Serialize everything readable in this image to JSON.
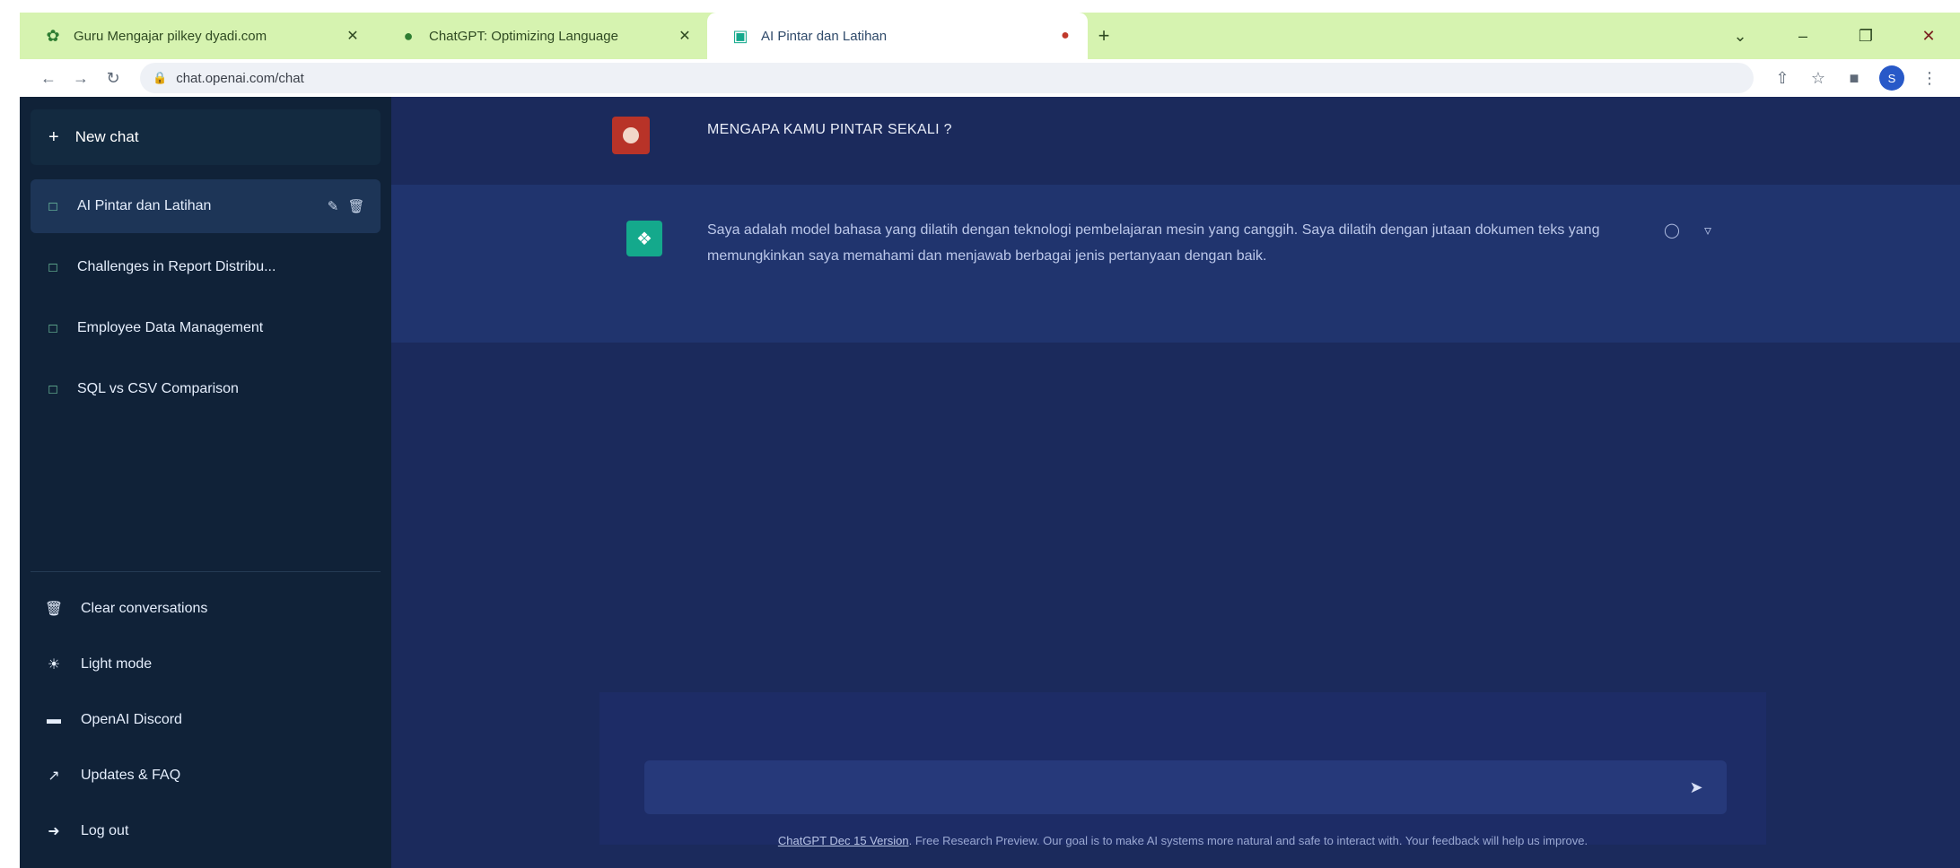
{
  "browser": {
    "tabs": [
      {
        "title": "Guru Mengajar pilkey dyadi.com",
        "icon": "twitter-bird-icon",
        "icon_color": "#2e7d32"
      },
      {
        "title": "ChatGPT: Optimizing Language",
        "icon": "openai-icon",
        "icon_color": "#2e7d32"
      },
      {
        "title": "AI Pintar dan Latihan",
        "icon": "chat-app-icon",
        "icon_color": "#14a98c"
      }
    ],
    "address": "chat.openai.com/chat",
    "profile_initial": "S"
  },
  "sidebar": {
    "new_chat_label": "New chat",
    "conversations": [
      {
        "label": "AI Pintar dan Latihan",
        "active": true
      },
      {
        "label": "Challenges in Report Distribu...",
        "active": false
      },
      {
        "label": "Employee Data Management",
        "active": false
      },
      {
        "label": "SQL vs CSV Comparison",
        "active": false
      }
    ],
    "bottom": [
      {
        "label": "Clear conversations",
        "icon": "trash-icon"
      },
      {
        "label": "Light mode",
        "icon": "sun-icon"
      },
      {
        "label": "OpenAI Discord",
        "icon": "discord-icon"
      },
      {
        "label": "Updates & FAQ",
        "icon": "external-link-icon"
      },
      {
        "label": "Log out",
        "icon": "logout-icon"
      }
    ]
  },
  "chat": {
    "user_message": "MENGAPA KAMU PINTAR SEKALI ?",
    "bot_message": "Saya adalah model bahasa yang dilatih dengan teknologi pembelajaran mesin yang canggih. Saya dilatih dengan jutaan dokumen teks yang memungkinkan saya memahami dan menjawab berbagai jenis pertanyaan dengan baik.",
    "composer_placeholder": "",
    "footer_link": "ChatGPT Dec 15 Version",
    "footer_text": ". Free Research Preview. Our goal is to make AI systems more natural and safe to interact with. Your feedback will help us improve."
  },
  "colors": {
    "sidebar_bg": "#102238",
    "main_bg": "#1b2a5c",
    "bot_row_bg": "#20346e",
    "tabbar_bg": "#d6f3b0"
  }
}
